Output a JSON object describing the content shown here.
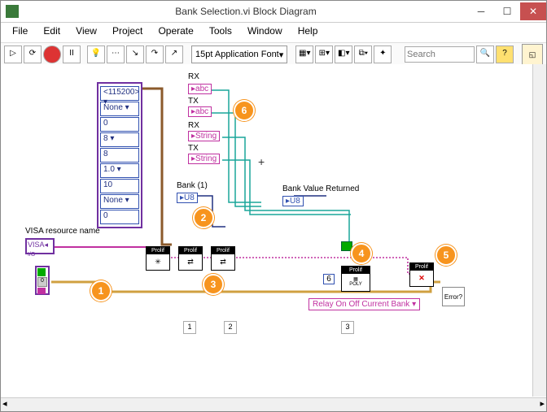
{
  "window": {
    "title": "Bank Selection.vi Block Diagram"
  },
  "menu": {
    "file": "File",
    "edit": "Edit",
    "view": "View",
    "project": "Project",
    "operate": "Operate",
    "tools": "Tools",
    "window": "Window",
    "help": "Help"
  },
  "toolbar": {
    "font": "15pt Application Font",
    "search_placeholder": "Search"
  },
  "cluster": {
    "header": "<115200>",
    "f1": "None",
    "f2": "0",
    "f3": "8",
    "f4": "8",
    "f5": "1.0",
    "f6": "10",
    "f7": "None",
    "f8": "0"
  },
  "labels": {
    "rx1": "RX",
    "tx1": "TX",
    "rx2": "RX",
    "tx2": "TX",
    "string1": "String",
    "string2": "String",
    "bank": "Bank (1)",
    "u8": "U8",
    "bank_val": "Bank Value Returned",
    "u8out": "U8",
    "visa_name": "VISA resource name",
    "visa": "VISA",
    "const6": "6",
    "poly": "POLY",
    "relay": "Relay On Off Current Bank",
    "error": "Error",
    "prolix": "Prolif"
  },
  "callouts": {
    "c1": "1",
    "c2": "2",
    "c3": "3",
    "c4": "4",
    "c5": "5",
    "c6": "6"
  },
  "seq": {
    "s1": "1",
    "s2": "2",
    "s3": "3"
  }
}
